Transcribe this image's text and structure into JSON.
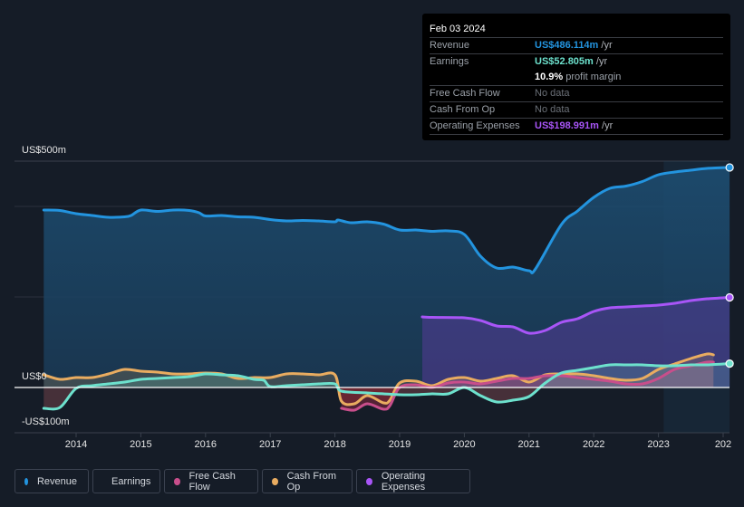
{
  "tooltip": {
    "date": "Feb 03 2024",
    "rows": [
      {
        "label": "Revenue",
        "value": "US$486.114m",
        "unit": "/yr",
        "color": "#2394df"
      },
      {
        "label": "Earnings",
        "value": "US$52.805m",
        "unit": "/yr",
        "color": "#6de1cd"
      },
      {
        "label": "",
        "value": "10.9%",
        "unit": "profit margin",
        "color": "#ffffff"
      },
      {
        "label": "Free Cash Flow",
        "value": "No data",
        "unit": "",
        "color": "#6b7078"
      },
      {
        "label": "Cash From Op",
        "value": "No data",
        "unit": "",
        "color": "#6b7078"
      },
      {
        "label": "Operating Expenses",
        "value": "US$198.991m",
        "unit": "/yr",
        "color": "#a855f7"
      }
    ]
  },
  "legend": [
    {
      "label": "Revenue",
      "color": "#2394df"
    },
    {
      "label": "Earnings",
      "color": "#6de1cd"
    },
    {
      "label": "Free Cash Flow",
      "color": "#c84e8b"
    },
    {
      "label": "Cash From Op",
      "color": "#e9ac60"
    },
    {
      "label": "Operating Expenses",
      "color": "#a855f7"
    }
  ],
  "chart_data": {
    "type": "area",
    "title": "",
    "xlabel": "",
    "ylabel": "",
    "y_tick_labels": [
      "US$500m",
      "US$0",
      "-US$100m"
    ],
    "ylim": [
      -100,
      500
    ],
    "x_tick_labels": [
      "2014",
      "2015",
      "2016",
      "2017",
      "2018",
      "2019",
      "2020",
      "2021",
      "2022",
      "2023",
      "202"
    ],
    "xlim": [
      2013.5,
      2024.1
    ],
    "highlight_from": 2023.08,
    "grid": true,
    "legend_position": "bottom",
    "series": [
      {
        "name": "Revenue",
        "color": "#2394df",
        "points": [
          [
            2013.5,
            392
          ],
          [
            2013.75,
            391
          ],
          [
            2014.0,
            384
          ],
          [
            2014.25,
            380
          ],
          [
            2014.5,
            376
          ],
          [
            2014.75,
            377
          ],
          [
            2014.85,
            380
          ],
          [
            2015.0,
            392
          ],
          [
            2015.25,
            389
          ],
          [
            2015.5,
            392
          ],
          [
            2015.75,
            391
          ],
          [
            2015.9,
            386
          ],
          [
            2016.0,
            379
          ],
          [
            2016.25,
            380
          ],
          [
            2016.5,
            377
          ],
          [
            2016.75,
            376
          ],
          [
            2017.0,
            371
          ],
          [
            2017.25,
            368
          ],
          [
            2017.5,
            369
          ],
          [
            2017.75,
            368
          ],
          [
            2018.0,
            366
          ],
          [
            2018.05,
            370
          ],
          [
            2018.25,
            364
          ],
          [
            2018.5,
            366
          ],
          [
            2018.75,
            361
          ],
          [
            2019.0,
            348
          ],
          [
            2019.25,
            348
          ],
          [
            2019.5,
            345
          ],
          [
            2019.75,
            346
          ],
          [
            2020.0,
            338
          ],
          [
            2020.25,
            290
          ],
          [
            2020.5,
            264
          ],
          [
            2020.75,
            266
          ],
          [
            2021.0,
            258
          ],
          [
            2021.1,
            262
          ],
          [
            2021.5,
            360
          ],
          [
            2021.75,
            390
          ],
          [
            2022.0,
            420
          ],
          [
            2022.25,
            440
          ],
          [
            2022.5,
            445
          ],
          [
            2022.75,
            455
          ],
          [
            2023.0,
            470
          ],
          [
            2023.25,
            476
          ],
          [
            2023.5,
            480
          ],
          [
            2023.75,
            484
          ],
          [
            2024.1,
            486.1
          ]
        ]
      },
      {
        "name": "Earnings",
        "color": "#6de1cd",
        "points": [
          [
            2013.5,
            -46
          ],
          [
            2013.75,
            -44
          ],
          [
            2014.0,
            -2
          ],
          [
            2014.25,
            4
          ],
          [
            2014.5,
            8
          ],
          [
            2014.75,
            12
          ],
          [
            2015.0,
            18
          ],
          [
            2015.25,
            20
          ],
          [
            2015.5,
            22
          ],
          [
            2015.75,
            24
          ],
          [
            2016.0,
            30
          ],
          [
            2016.25,
            28
          ],
          [
            2016.5,
            26
          ],
          [
            2016.75,
            18
          ],
          [
            2016.9,
            16
          ],
          [
            2017.0,
            2
          ],
          [
            2017.25,
            4
          ],
          [
            2017.5,
            6
          ],
          [
            2017.75,
            8
          ],
          [
            2018.0,
            8
          ],
          [
            2018.1,
            -8
          ],
          [
            2018.5,
            -12
          ],
          [
            2018.75,
            -14
          ],
          [
            2019.0,
            -16
          ],
          [
            2019.25,
            -16
          ],
          [
            2019.5,
            -14
          ],
          [
            2019.75,
            -14
          ],
          [
            2020.0,
            0
          ],
          [
            2020.25,
            -18
          ],
          [
            2020.5,
            -32
          ],
          [
            2020.75,
            -28
          ],
          [
            2021.0,
            -20
          ],
          [
            2021.25,
            10
          ],
          [
            2021.5,
            32
          ],
          [
            2021.75,
            38
          ],
          [
            2022.0,
            44
          ],
          [
            2022.25,
            50
          ],
          [
            2022.5,
            50
          ],
          [
            2022.75,
            50
          ],
          [
            2023.0,
            48
          ],
          [
            2023.25,
            48
          ],
          [
            2023.5,
            50
          ],
          [
            2023.75,
            50
          ],
          [
            2024.1,
            52.8
          ]
        ]
      },
      {
        "name": "Free Cash Flow",
        "color": "#c84e8b",
        "points": [
          [
            2018.1,
            -46
          ],
          [
            2018.3,
            -50
          ],
          [
            2018.5,
            -36
          ],
          [
            2018.75,
            -48
          ],
          [
            2018.85,
            -40
          ],
          [
            2019.0,
            0
          ],
          [
            2019.25,
            6
          ],
          [
            2019.5,
            0
          ],
          [
            2019.75,
            10
          ],
          [
            2020.0,
            12
          ],
          [
            2020.25,
            8
          ],
          [
            2020.5,
            14
          ],
          [
            2020.75,
            20
          ],
          [
            2021.0,
            20
          ],
          [
            2021.25,
            26
          ],
          [
            2021.5,
            26
          ],
          [
            2021.75,
            22
          ],
          [
            2022.0,
            18
          ],
          [
            2022.25,
            14
          ],
          [
            2022.5,
            8
          ],
          [
            2022.75,
            8
          ],
          [
            2023.0,
            20
          ],
          [
            2023.25,
            40
          ],
          [
            2023.5,
            48
          ],
          [
            2023.75,
            56
          ],
          [
            2023.85,
            56
          ]
        ]
      },
      {
        "name": "Cash From Op",
        "color": "#e9ac60",
        "points": [
          [
            2013.5,
            28
          ],
          [
            2013.75,
            18
          ],
          [
            2014.0,
            22
          ],
          [
            2014.25,
            22
          ],
          [
            2014.5,
            30
          ],
          [
            2014.75,
            40
          ],
          [
            2015.0,
            36
          ],
          [
            2015.25,
            34
          ],
          [
            2015.5,
            30
          ],
          [
            2015.75,
            30
          ],
          [
            2016.0,
            32
          ],
          [
            2016.25,
            30
          ],
          [
            2016.5,
            20
          ],
          [
            2016.75,
            22
          ],
          [
            2017.0,
            22
          ],
          [
            2017.25,
            30
          ],
          [
            2017.5,
            30
          ],
          [
            2017.75,
            28
          ],
          [
            2018.0,
            28
          ],
          [
            2018.1,
            -30
          ],
          [
            2018.3,
            -36
          ],
          [
            2018.5,
            -18
          ],
          [
            2018.75,
            -34
          ],
          [
            2018.85,
            -28
          ],
          [
            2019.0,
            10
          ],
          [
            2019.25,
            14
          ],
          [
            2019.5,
            4
          ],
          [
            2019.75,
            18
          ],
          [
            2020.0,
            22
          ],
          [
            2020.25,
            14
          ],
          [
            2020.5,
            20
          ],
          [
            2020.75,
            26
          ],
          [
            2021.0,
            12
          ],
          [
            2021.25,
            28
          ],
          [
            2021.5,
            30
          ],
          [
            2021.75,
            30
          ],
          [
            2022.0,
            26
          ],
          [
            2022.25,
            20
          ],
          [
            2022.5,
            16
          ],
          [
            2022.75,
            20
          ],
          [
            2023.0,
            40
          ],
          [
            2023.25,
            52
          ],
          [
            2023.5,
            64
          ],
          [
            2023.75,
            74
          ],
          [
            2023.85,
            72
          ]
        ]
      },
      {
        "name": "Operating Expenses",
        "color": "#a855f7",
        "points": [
          [
            2019.35,
            156
          ],
          [
            2019.5,
            155
          ],
          [
            2020.0,
            154
          ],
          [
            2020.25,
            148
          ],
          [
            2020.5,
            136
          ],
          [
            2020.75,
            134
          ],
          [
            2021.0,
            120
          ],
          [
            2021.25,
            126
          ],
          [
            2021.5,
            144
          ],
          [
            2021.75,
            152
          ],
          [
            2022.0,
            168
          ],
          [
            2022.25,
            176
          ],
          [
            2022.5,
            178
          ],
          [
            2022.75,
            180
          ],
          [
            2023.0,
            182
          ],
          [
            2023.25,
            186
          ],
          [
            2023.5,
            192
          ],
          [
            2023.75,
            196
          ],
          [
            2024.1,
            199
          ]
        ]
      }
    ]
  }
}
